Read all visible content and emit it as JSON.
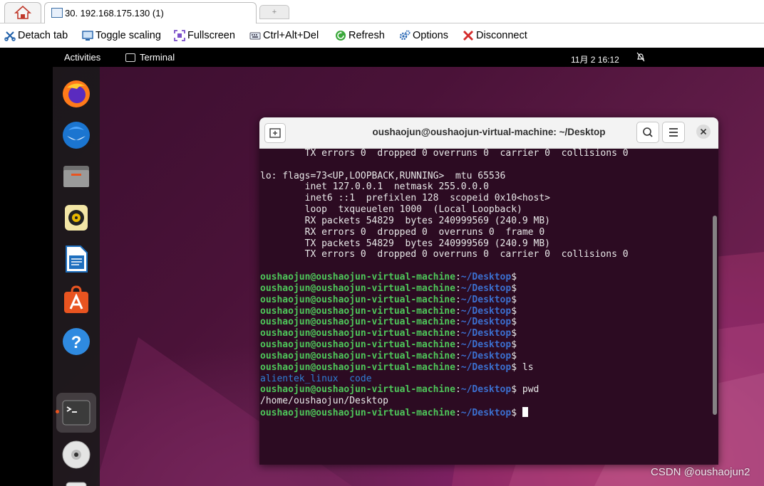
{
  "browser": {
    "active_tab_title": "30. 192.168.175.130 (1)",
    "new_tab_symbol": "+"
  },
  "toolbar": {
    "detach": "Detach tab",
    "toggle_scaling": "Toggle scaling",
    "fullscreen": "Fullscreen",
    "ctrl_alt_del": "Ctrl+Alt+Del",
    "refresh": "Refresh",
    "options": "Options",
    "disconnect": "Disconnect"
  },
  "topbar": {
    "activities": "Activities",
    "app_name": "Terminal",
    "clock": "11月 2  16:12"
  },
  "dock": {
    "items": [
      {
        "icon": "firefox-icon"
      },
      {
        "icon": "thunderbird-icon"
      },
      {
        "icon": "files-icon"
      },
      {
        "icon": "rhythmbox-icon"
      },
      {
        "icon": "libreoffice-writer-icon"
      },
      {
        "icon": "ubuntu-software-icon"
      },
      {
        "icon": "help-icon"
      },
      {
        "icon": "terminal-icon"
      },
      {
        "icon": "dvd-icon"
      },
      {
        "icon": "trash-icon"
      }
    ]
  },
  "terminal": {
    "title": "oushaojun@oushaojun-virtual-machine: ~/Desktop",
    "user_host": "oushaojun@oushaojun-virtual-machine",
    "path": "~/Desktop",
    "lines": [
      {
        "kind": "out",
        "text": "        TX errors 0  dropped 0 overruns 0  carrier 0  collisions 0"
      },
      {
        "kind": "out",
        "text": ""
      },
      {
        "kind": "out",
        "text": "lo: flags=73<UP,LOOPBACK,RUNNING>  mtu 65536"
      },
      {
        "kind": "out",
        "text": "        inet 127.0.0.1  netmask 255.0.0.0"
      },
      {
        "kind": "out",
        "text": "        inet6 ::1  prefixlen 128  scopeid 0x10<host>"
      },
      {
        "kind": "out",
        "text": "        loop  txqueuelen 1000  (Local Loopback)"
      },
      {
        "kind": "out",
        "text": "        RX packets 54829  bytes 240999569 (240.9 MB)"
      },
      {
        "kind": "out",
        "text": "        RX errors 0  dropped 0  overruns 0  frame 0"
      },
      {
        "kind": "out",
        "text": "        TX packets 54829  bytes 240999569 (240.9 MB)"
      },
      {
        "kind": "out",
        "text": "        TX errors 0  dropped 0 overruns 0  carrier 0  collisions 0"
      },
      {
        "kind": "out",
        "text": ""
      },
      {
        "kind": "prompt",
        "cmd": ""
      },
      {
        "kind": "prompt",
        "cmd": ""
      },
      {
        "kind": "prompt",
        "cmd": ""
      },
      {
        "kind": "prompt",
        "cmd": ""
      },
      {
        "kind": "prompt",
        "cmd": ""
      },
      {
        "kind": "prompt",
        "cmd": ""
      },
      {
        "kind": "prompt",
        "cmd": ""
      },
      {
        "kind": "prompt",
        "cmd": ""
      },
      {
        "kind": "prompt",
        "cmd": " ls"
      },
      {
        "kind": "dirs",
        "text": "alientek_linux  code"
      },
      {
        "kind": "prompt",
        "cmd": " pwd"
      },
      {
        "kind": "out",
        "text": "/home/oushaojun/Desktop"
      },
      {
        "kind": "prompt",
        "cmd": " ",
        "cursor": true
      }
    ]
  },
  "watermark": "CSDN @oushaojun2"
}
